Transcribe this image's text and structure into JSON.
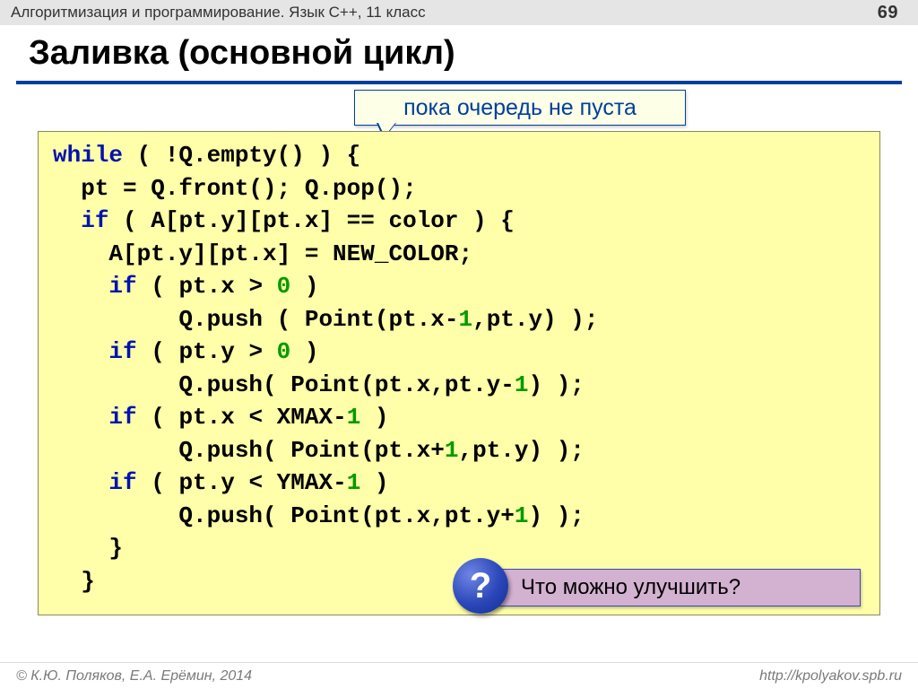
{
  "top": {
    "subject": "Алгоритмизация и программирование. Язык C++, 11 класс",
    "page": "69"
  },
  "title": "Заливка (основной цикл)",
  "callout_queue": "пока очередь не пуста",
  "code": {
    "l1a": "while",
    "l1b": " ( !Q.empty() ) {",
    "l2": "  pt = Q.front(); Q.pop();",
    "l3a": "  ",
    "l3kw": "if",
    "l3b": " ( A[pt.y][pt.x] == color ) {",
    "l4": "    A[pt.y][pt.x] = NEW_COLOR;",
    "l5a": "    ",
    "l5kw": "if",
    "l5b": " ( pt.x > ",
    "l5n": "0",
    "l5c": " )",
    "l6a": "         Q.push ( Point(pt.x-",
    "l6n": "1",
    "l6b": ",pt.y) );",
    "l7a": "    ",
    "l7kw": "if",
    "l7b": " ( pt.y > ",
    "l7n": "0",
    "l7c": " )",
    "l8a": "         Q.push( Point(pt.x,pt.y-",
    "l8n": "1",
    "l8b": ") );",
    "l9a": "    ",
    "l9kw": "if",
    "l9b": " ( pt.x < XMAX-",
    "l9n": "1",
    "l9c": " )",
    "l10a": "         Q.push( Point(pt.x+",
    "l10n": "1",
    "l10b": ",pt.y) );",
    "l11a": "    ",
    "l11kw": "if",
    "l11b": " ( pt.y < YMAX-",
    "l11n": "1",
    "l11c": " )",
    "l12a": "         Q.push( Point(pt.x,pt.y+",
    "l12n": "1",
    "l12b": ") );",
    "l13": "    }",
    "l14": "  }"
  },
  "question": {
    "mark": "?",
    "text": "Что можно улучшить?"
  },
  "footer": {
    "copyright": "© К.Ю. Поляков, Е.А. Ерёмин, 2014",
    "url": "http://kpolyakov.spb.ru"
  }
}
